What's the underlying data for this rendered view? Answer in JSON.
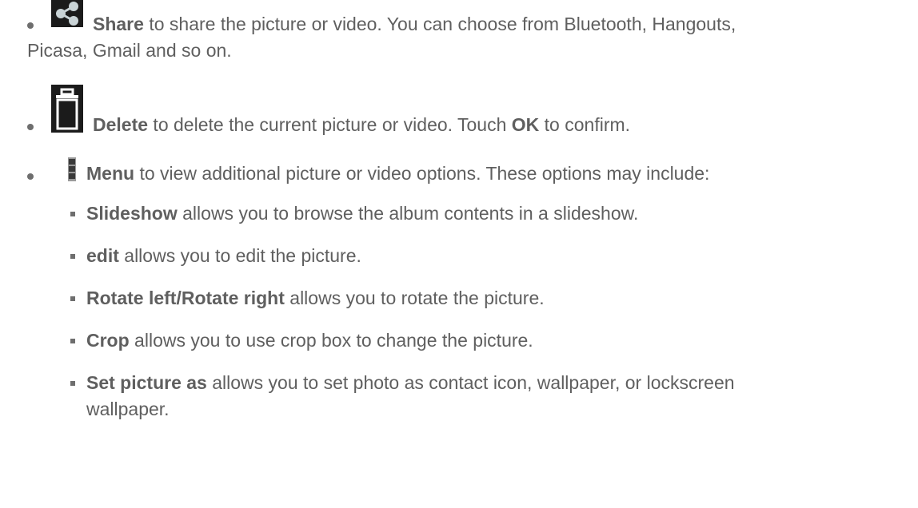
{
  "items": [
    {
      "icon": "share-icon",
      "bold": "Share",
      "line1": " to share the picture or video. You can choose from Bluetooth, Hangouts,",
      "line2": "Picasa, Gmail and so on."
    },
    {
      "icon": "trash-icon",
      "bold": "Delete",
      "text_a": " to delete the current picture or video. Touch ",
      "bold2": "OK",
      "text_b": " to confirm."
    },
    {
      "icon": "overflow-menu-icon",
      "bold": "Menu",
      "text": " to view additional picture or video options. These options may include:"
    }
  ],
  "subitems": [
    {
      "bold": "Slideshow",
      "text": " allows you to browse the album contents in a slideshow."
    },
    {
      "bold": "edit",
      "text": " allows you to edit the picture."
    },
    {
      "bold": "Rotate left/Rotate right",
      "text": " allows you to rotate the picture."
    },
    {
      "bold": "Crop",
      "text": " allows you to use crop box to change the picture."
    },
    {
      "bold": "Set picture as",
      "text": " allows you to set photo as contact icon, wallpaper, or lockscreen",
      "line2": "wallpaper."
    }
  ],
  "colors": {
    "text": "#5f5f5f",
    "icon_bg": "#1b1b1b"
  }
}
